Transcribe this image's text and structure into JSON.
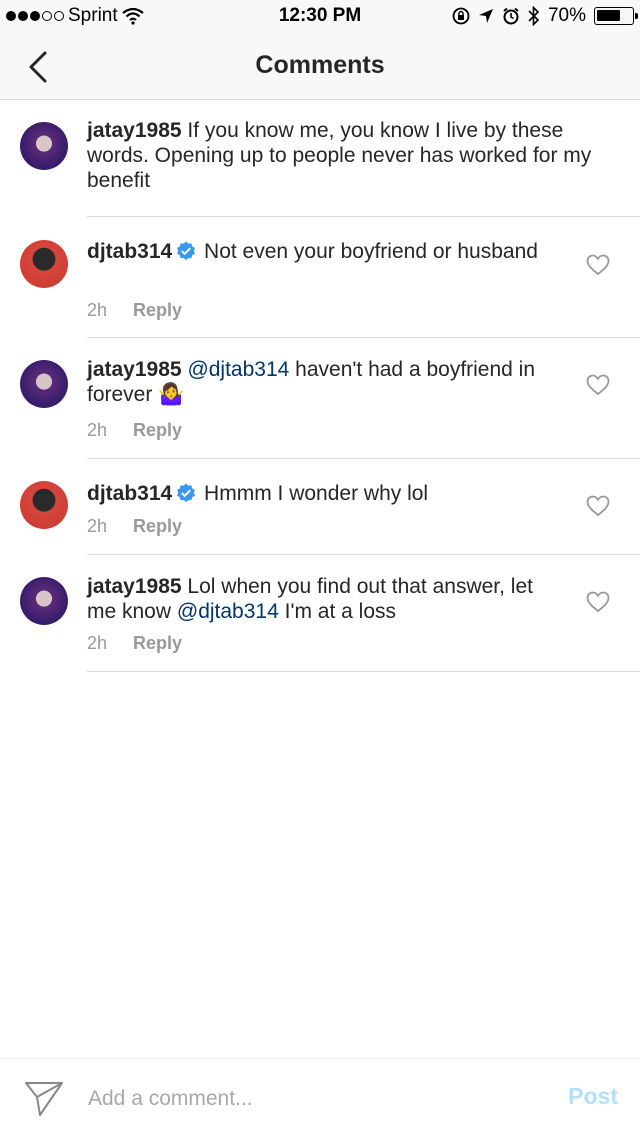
{
  "status_bar": {
    "carrier": "Sprint",
    "time": "12:30 PM",
    "battery_percent": "70%",
    "battery_level": 0.7,
    "signal_bars_filled": 3,
    "signal_bars_total": 5
  },
  "header": {
    "title": "Comments"
  },
  "caption": {
    "username": "jatay1985",
    "text": " If you know me, you know I live by these words. Opening up to people never has worked for my benefit"
  },
  "comments": [
    {
      "username": "djtab314",
      "verified": true,
      "text": "Not even your boyfriend or husband",
      "time": "2h",
      "reply_label": "Reply"
    },
    {
      "username": "jatay1985",
      "verified": false,
      "mention": "@djtab314",
      "text": " haven't had a boyfriend in forever ",
      "emoji": "🤷‍♀️",
      "time": "2h",
      "reply_label": "Reply"
    },
    {
      "username": "djtab314",
      "verified": true,
      "text": "Hmmm I wonder why lol",
      "time": "2h",
      "reply_label": "Reply"
    },
    {
      "username": "jatay1985",
      "verified": false,
      "text_before": " Lol when you find out that answer, let me know ",
      "mention": "@djtab314",
      "text_after": " I'm at a loss",
      "time": "2h",
      "reply_label": "Reply"
    }
  ],
  "composer": {
    "placeholder": "Add a comment...",
    "post_label": "Post"
  },
  "colors": {
    "mention": "#003569",
    "verified": "#3897f0",
    "post_disabled": "#b2dffc",
    "meta": "#999999"
  }
}
